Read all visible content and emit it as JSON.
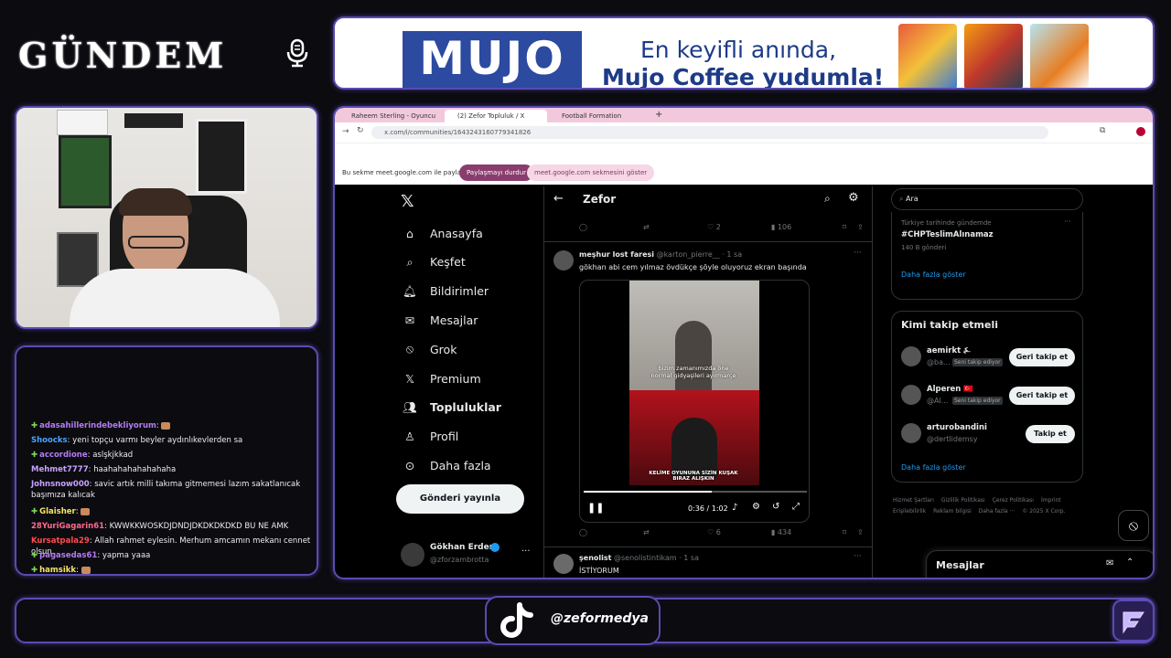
{
  "stream": {
    "logo_text": "GÜNDEM",
    "tiktok_handle": "@zeformedya"
  },
  "ad": {
    "brand": "MUJO",
    "line1": "En keyifli anında,",
    "line2": "Mujo Coffee yudumla!"
  },
  "chat": {
    "messages": [
      {
        "user": "adasahillerindebekliyorum",
        "text": ": ",
        "color": "#b57cf2",
        "plus": true,
        "emote": true
      },
      {
        "user": "Shoocks",
        "text": ": yeni topçu varmı beyler aydınlıkevlerden sa",
        "color": "#4aa3ff",
        "plus": false,
        "emote": false
      },
      {
        "user": "accordione",
        "text": ": aslşkjkkad",
        "color": "#b57cf2",
        "plus": true,
        "emote": false
      },
      {
        "user": "Mehmet7777",
        "text": ": haahahahahahahaha",
        "color": "#c8a2ff",
        "plus": false,
        "emote": false
      },
      {
        "user": "Johnsnow000",
        "text": ": savic artık milli takıma gitmemesi lazım sakatlanıcak başımıza kalıcak",
        "color": "#c8a2ff",
        "plus": false,
        "emote": false
      },
      {
        "user": "Glaisher",
        "text": ": ",
        "color": "#f5e663",
        "plus": true,
        "emote": true
      },
      {
        "user": "28YuriGagarin61",
        "text": ": KWWKKWOSKDJDNDJDKDKDKDKD BU NE AMK",
        "color": "#ff6b8b",
        "plus": false,
        "emote": false
      },
      {
        "user": "Kursatpala29",
        "text": ": Allah rahmet eylesin. Merhum amcamın mekanı cennet olsun.",
        "color": "#ff4d4d",
        "plus": false,
        "emote": false
      },
      {
        "user": "pagasedas61",
        "text": ": yapma yaaa",
        "color": "#b57cf2",
        "plus": true,
        "emote": false
      },
      {
        "user": "hamsikk",
        "text": ": ",
        "color": "#f5e663",
        "plus": true,
        "emote": true
      }
    ]
  },
  "browser": {
    "tabs": [
      {
        "label": "Raheem Sterling - Oyuncu prof",
        "active": false
      },
      {
        "label": "(2) Zefor Topluluk / X",
        "active": true
      },
      {
        "label": "Football Formation Creator Re",
        "active": false
      }
    ],
    "url": "x.com/i/communities/1643243160779341826",
    "share_text": "Bu sekme meet.google.com ile paylaşılıyor",
    "stop_share": "Paylaşmayı durdur",
    "show_tab": "meet.google.com sekmesini göster"
  },
  "x": {
    "nav": [
      {
        "label": "Anasayfa",
        "icon": "home-icon"
      },
      {
        "label": "Keşfet",
        "icon": "search-icon"
      },
      {
        "label": "Bildirimler",
        "icon": "bell-icon"
      },
      {
        "label": "Mesajlar",
        "icon": "mail-icon"
      },
      {
        "label": "Grok",
        "icon": "grok-icon"
      },
      {
        "label": "Premium",
        "icon": "x-premium-icon"
      },
      {
        "label": "Topluluklar",
        "icon": "communities-icon"
      },
      {
        "label": "Profil",
        "icon": "profile-icon"
      },
      {
        "label": "Daha fazla",
        "icon": "more-circle-icon"
      }
    ],
    "post_button": "Gönderi yayınla",
    "account": {
      "name": "Gökhan Erdem",
      "handle": "@zforzambrotta"
    },
    "header_title": "Zefor",
    "prev_actions": {
      "likes": "2",
      "views": "106"
    },
    "tweet1": {
      "name": "meşhur lost faresi",
      "handle": "@karton_pierre__",
      "time": "· 1 sa",
      "text": "gökhan abi cem yılmaz övdükçe şöyle oluyoruz ekran başında",
      "video_caption_top": "bizim zamanımızda öne normal gidyaşileri ayırmarçe",
      "video_caption_bottom": "KELİME OYUNUNA SİZİN KUŞAK BIRAZ ALIŞKIN",
      "video_time": "0:36 / 1:02",
      "likes": "6",
      "views": "434"
    },
    "tweet2": {
      "name": "şenolist",
      "handle": "@senolistintikam",
      "time": "· 1 sa",
      "text": "İSTİYORUM"
    },
    "search_placeholder": "Ara",
    "trend": {
      "context": "Türkiye tarihinde gündemde",
      "tag": "#CHPTeslimAlınamaz",
      "count": "140 B gönderi",
      "show_more": "Daha fazla göster"
    },
    "who_to_follow": {
      "title": "Kimi takip etmeli",
      "users": [
        {
          "name": "aemirkt ⍼",
          "handle": "@ba...",
          "badge": "Seni takip ediyor",
          "button": "Geri takip et"
        },
        {
          "name": "Alperen 🇹🇷",
          "handle": "@Al...",
          "badge": "Seni takip ediyor",
          "button": "Geri takip et"
        },
        {
          "name": "arturobandini",
          "handle": "@dertlidemsy",
          "badge": "",
          "button": "Takip et"
        }
      ],
      "show_more": "Daha fazla göster"
    },
    "footer_links": [
      "Hizmet Şartları",
      "Gizlilik Politikası",
      "Çerez Politikası",
      "İmprint",
      "Erişilebilirlik",
      "Reklam bilgisi",
      "Daha fazla ···",
      "© 2025 X Corp."
    ],
    "messages_drawer": "Mesajlar"
  },
  "colors": {
    "frame": "#5a4bb3",
    "x_bg": "#000000",
    "x_blue": "#1d9bf0",
    "ad_blue": "#2b4aa0"
  }
}
